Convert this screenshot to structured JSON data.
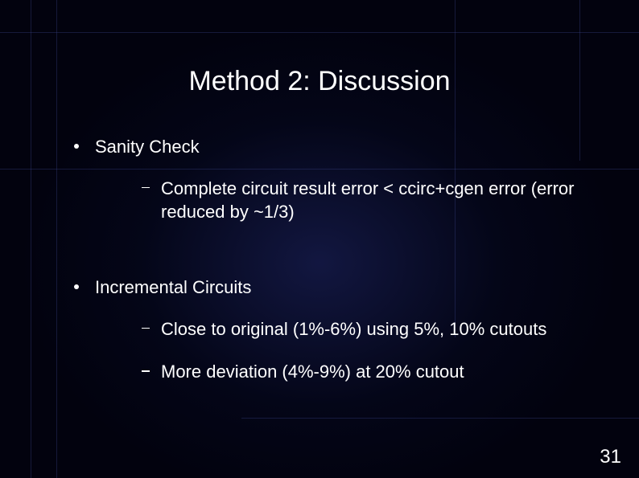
{
  "title": "Method 2: Discussion",
  "bullets": {
    "b1": {
      "label": "Sanity Check",
      "sub": {
        "s1": "Complete circuit result error < ccirc+cgen error (error reduced by ~1/3)"
      }
    },
    "b2": {
      "label": "Incremental Circuits",
      "sub": {
        "s1": "Close to original (1%-6%) using 5%, 10% cutouts",
        "s2": "More deviation (4%-9%) at 20% cutout"
      }
    }
  },
  "page_number": "31"
}
